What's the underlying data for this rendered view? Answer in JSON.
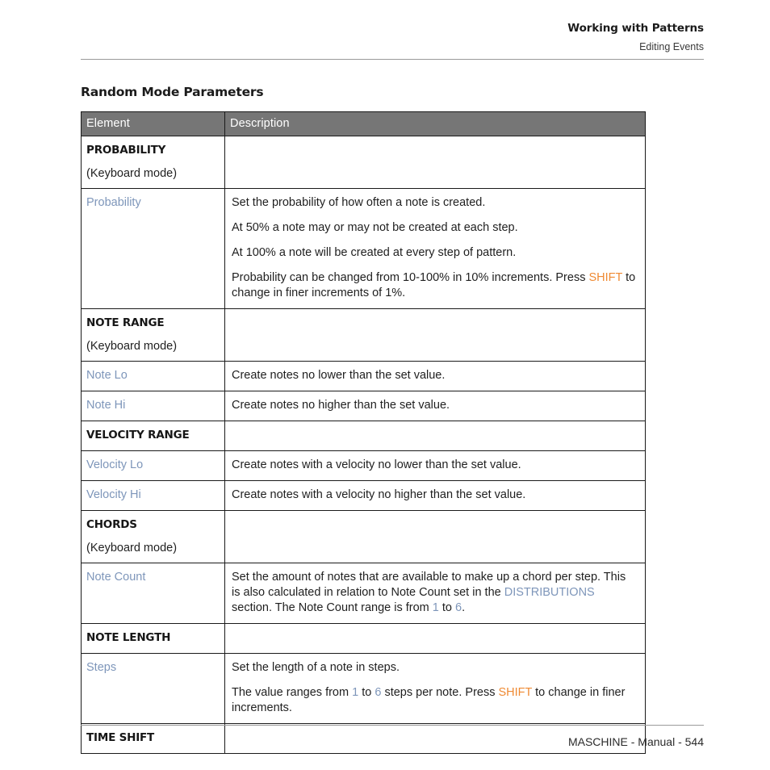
{
  "running_head": {
    "chapter": "Working with Patterns",
    "section": "Editing Events"
  },
  "section_heading": "Random Mode Parameters",
  "colors": {
    "table_header_bg": "#767676",
    "link_blue": "#7e96ba",
    "key_orange": "#ef8a33",
    "border": "#1a1a1a",
    "rule": "#9a9a9a"
  },
  "table": {
    "columns": [
      "Element",
      "Description"
    ],
    "rows": [
      {
        "kind": "group",
        "element_title": "PROBABILITY",
        "element_note": "(Keyboard mode)",
        "description": []
      },
      {
        "kind": "param",
        "element": "Probability",
        "description": [
          "Set the probability of how often a note is created.",
          "At 50% a note may or may not be created at each step.",
          "At 100% a note will be created at every step of pattern.",
          "Probability can be changed from 10-100% in 10% increments. Press SHIFT to change in finer increments of 1%."
        ],
        "para4": {
          "pre": "Probability can be changed from 10-100% in 10% increments. Press ",
          "key": "SHIFT",
          "post": " to change in finer increments of 1%."
        }
      },
      {
        "kind": "group",
        "element_title": "NOTE RANGE",
        "element_note": "(Keyboard mode)",
        "description": []
      },
      {
        "kind": "param",
        "element": "Note Lo",
        "description": [
          "Create notes no lower than the set value."
        ]
      },
      {
        "kind": "param",
        "element": "Note Hi",
        "description": [
          "Create notes no higher than the set value."
        ]
      },
      {
        "kind": "group",
        "element_title": "VELOCITY RANGE",
        "element_note": "",
        "description": []
      },
      {
        "kind": "param",
        "element": "Velocity Lo",
        "description": [
          "Create notes with a velocity no lower than the set value."
        ]
      },
      {
        "kind": "param",
        "element": "Velocity Hi",
        "description": [
          "Create notes with a velocity no higher than the set value."
        ]
      },
      {
        "kind": "group",
        "element_title": "CHORDS",
        "element_note": "(Keyboard mode)",
        "description": []
      },
      {
        "kind": "param",
        "element": "Note Count",
        "description": [
          "Set the amount of notes that are available to make up a chord per step. This is also calculated in relation to Note Count set in the DISTRIBUTIONS section. The Note Count range is from 1 to 6."
        ],
        "rich": {
          "seg1": "Set the amount of notes that are available to make up a chord per step. This is also calculated in relation to Note Count set in the ",
          "link": "DISTRIBUTIONS",
          "seg2": " section. The Note Count range is from ",
          "num1": "1",
          "seg3": " to ",
          "num2": "6",
          "seg4": "."
        }
      },
      {
        "kind": "group",
        "element_title": "NOTE LENGTH",
        "element_note": "",
        "description": []
      },
      {
        "kind": "param",
        "element": "Steps",
        "description": [
          "Set the length of a note in steps.",
          "The value ranges from 1 to 6 steps per note. Press SHIFT to change in finer increments."
        ],
        "rich2": {
          "seg1": "The value ranges from ",
          "num1": "1",
          "seg2": " to ",
          "num2": "6",
          "seg3": " steps per note. Press ",
          "key": "SHIFT",
          "seg4": " to change in finer increments."
        }
      },
      {
        "kind": "group",
        "element_title": "TIME SHIFT",
        "element_note": "",
        "description": []
      }
    ]
  },
  "footer": "MASCHINE - Manual - 544"
}
